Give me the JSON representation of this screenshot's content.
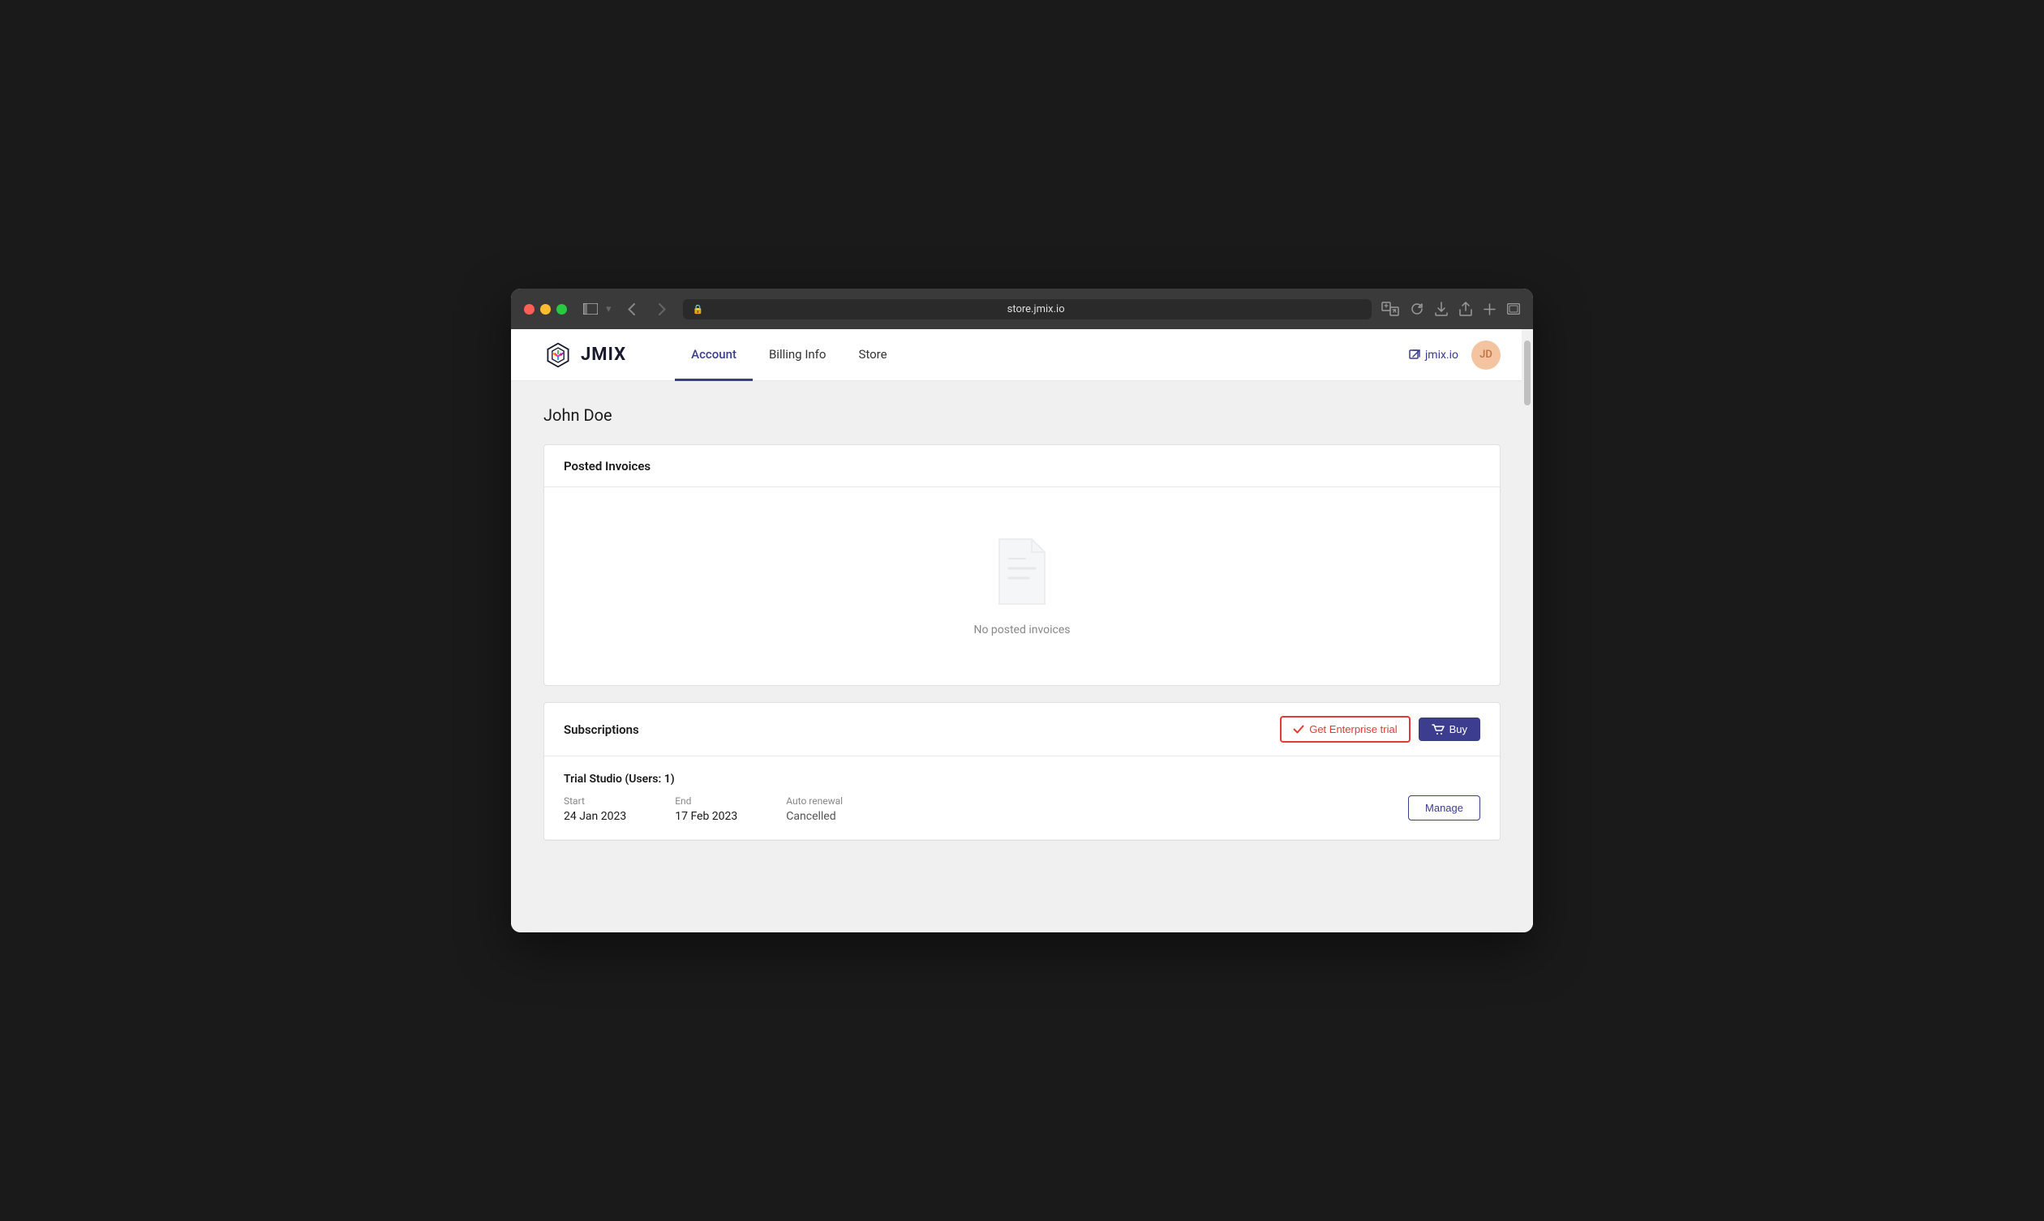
{
  "browser": {
    "url": "store.jmix.io",
    "back_btn": "‹",
    "forward_btn": "›"
  },
  "nav": {
    "logo_text": "JMIX",
    "tabs": [
      {
        "id": "account",
        "label": "Account",
        "active": true
      },
      {
        "id": "billing",
        "label": "Billing Info",
        "active": false
      },
      {
        "id": "store",
        "label": "Store",
        "active": false
      }
    ],
    "external_link": "jmix.io",
    "user_initials": "JD"
  },
  "page": {
    "title": "John Doe"
  },
  "invoices": {
    "section_title": "Posted Invoices",
    "empty_text": "No posted invoices"
  },
  "subscriptions": {
    "section_title": "Subscriptions",
    "get_enterprise_trial_label": "Get Enterprise trial",
    "buy_label": "Buy",
    "items": [
      {
        "name": "Trial Studio (Users: 1)",
        "start_label": "Start",
        "start_value": "24 Jan 2023",
        "end_label": "End",
        "end_value": "17 Feb 2023",
        "renewal_label": "Auto renewal",
        "renewal_value": "Cancelled",
        "manage_label": "Manage"
      }
    ]
  }
}
